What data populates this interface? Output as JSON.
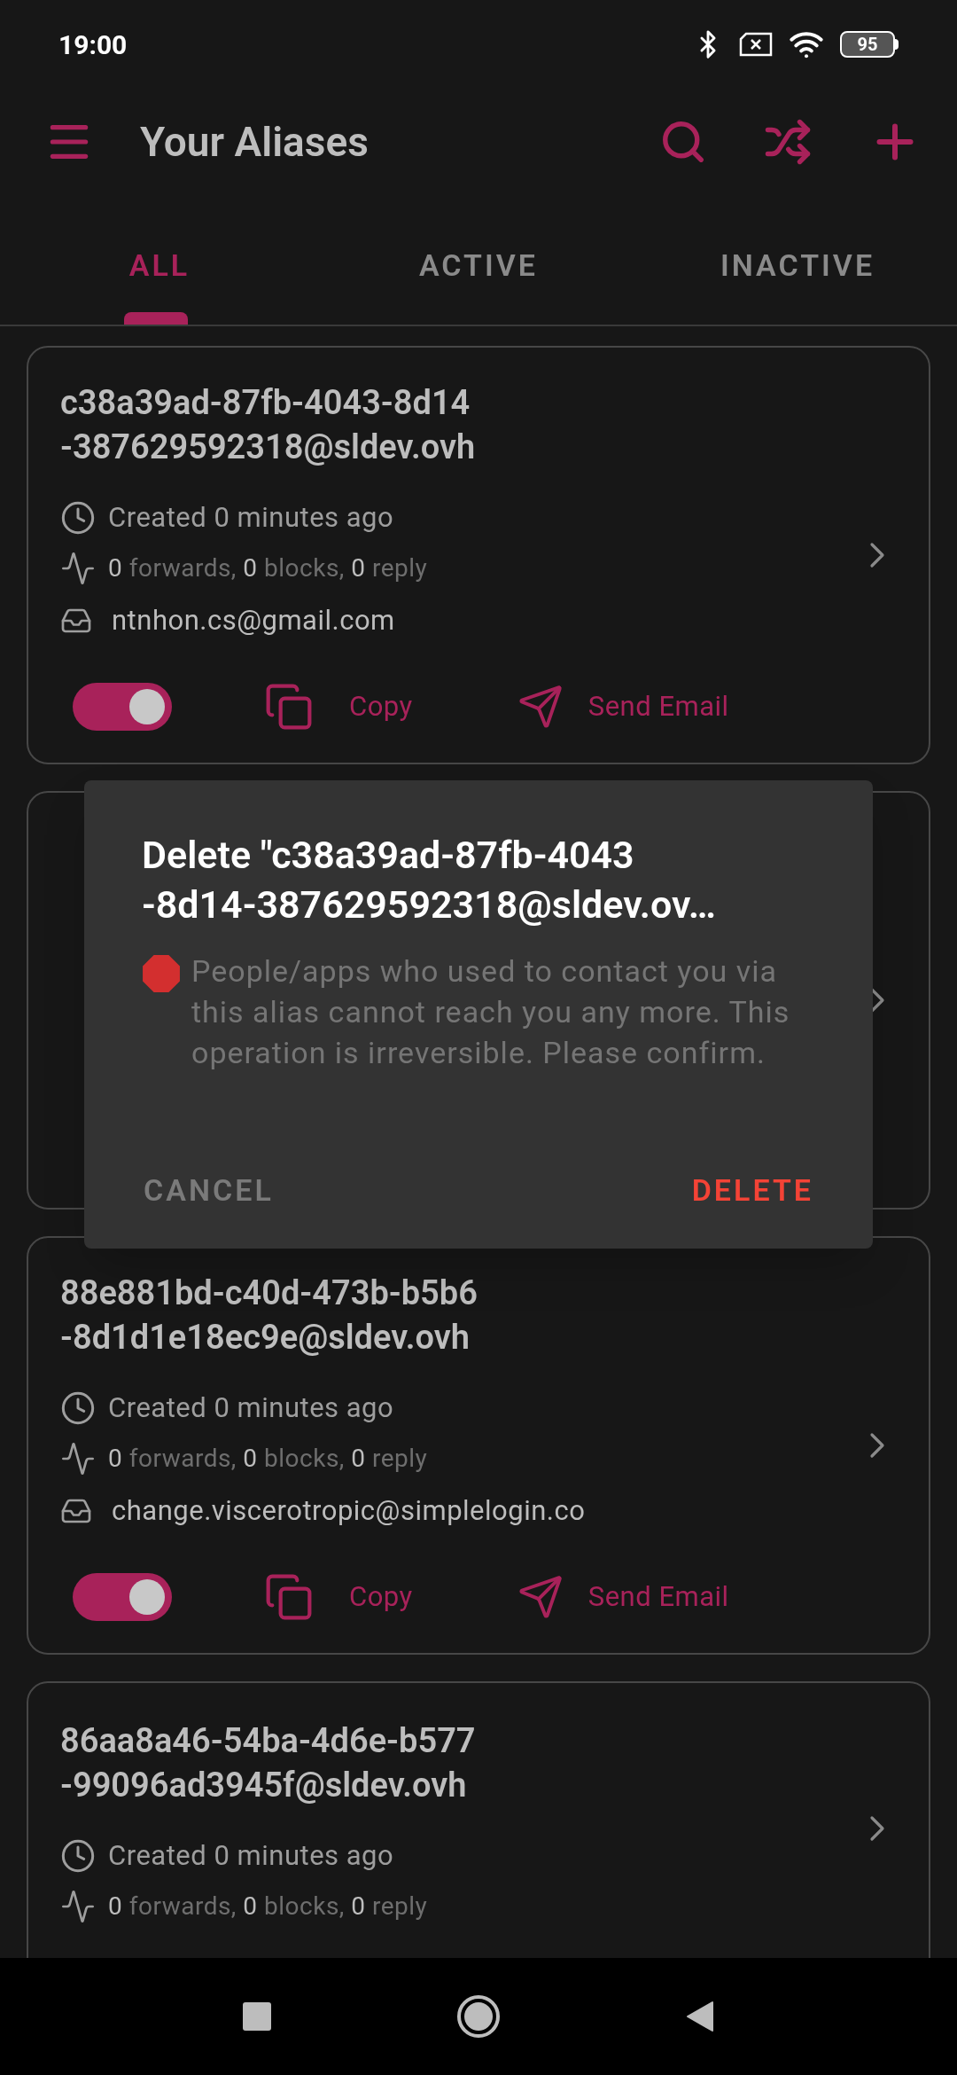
{
  "status_bar": {
    "time": "19:00",
    "battery": "95"
  },
  "app_bar": {
    "title": "Your Aliases"
  },
  "tabs": [
    {
      "label": "ALL",
      "selected": true
    },
    {
      "label": "ACTIVE",
      "selected": false
    },
    {
      "label": "INACTIVE",
      "selected": false
    }
  ],
  "aliases": [
    {
      "kind": "full",
      "title_lines": [
        "c38a39ad-87fb-4043-8d14",
        "-387629592318@sldev.ovh"
      ],
      "created": "Created 0 minutes ago",
      "stats": [
        {
          "count": "0",
          "label": "forwards,"
        },
        {
          "count": "0",
          "label": "blocks,"
        },
        {
          "count": "0",
          "label": "reply"
        }
      ],
      "mailbox": "ntnhon.cs@gmail.com",
      "enabled": true,
      "copy_label": "Copy",
      "send_label": "Send Email"
    },
    {
      "kind": "covered"
    },
    {
      "kind": "full",
      "title_lines": [
        "88e881bd-c40d-473b-b5b6",
        "-8d1d1e18ec9e@sldev.ovh"
      ],
      "created": "Created 0 minutes ago",
      "stats": [
        {
          "count": "0",
          "label": "forwards,"
        },
        {
          "count": "0",
          "label": "blocks,"
        },
        {
          "count": "0",
          "label": "reply"
        }
      ],
      "mailbox": "change.viscerotropic@simplelogin.co",
      "enabled": true,
      "copy_label": "Copy",
      "send_label": "Send Email"
    },
    {
      "kind": "cut",
      "title_lines": [
        "86aa8a46-54ba-4d6e-b577",
        "-99096ad3945f@sldev.ovh"
      ],
      "created": "Created 0 minutes ago",
      "stats": [
        {
          "count": "0",
          "label": "forwards,"
        },
        {
          "count": "0",
          "label": "blocks,"
        },
        {
          "count": "0",
          "label": "reply"
        }
      ]
    }
  ],
  "dialog": {
    "title_lines": [
      "Delete \"c38a39ad-87fb-4043",
      "-8d14-387629592318@sldev.ov…"
    ],
    "message": "People/apps who used to contact you via this alias cannot reach you any more. This operation is irreversible. Please confirm.",
    "cancel": "CANCEL",
    "confirm": "DELETE"
  }
}
